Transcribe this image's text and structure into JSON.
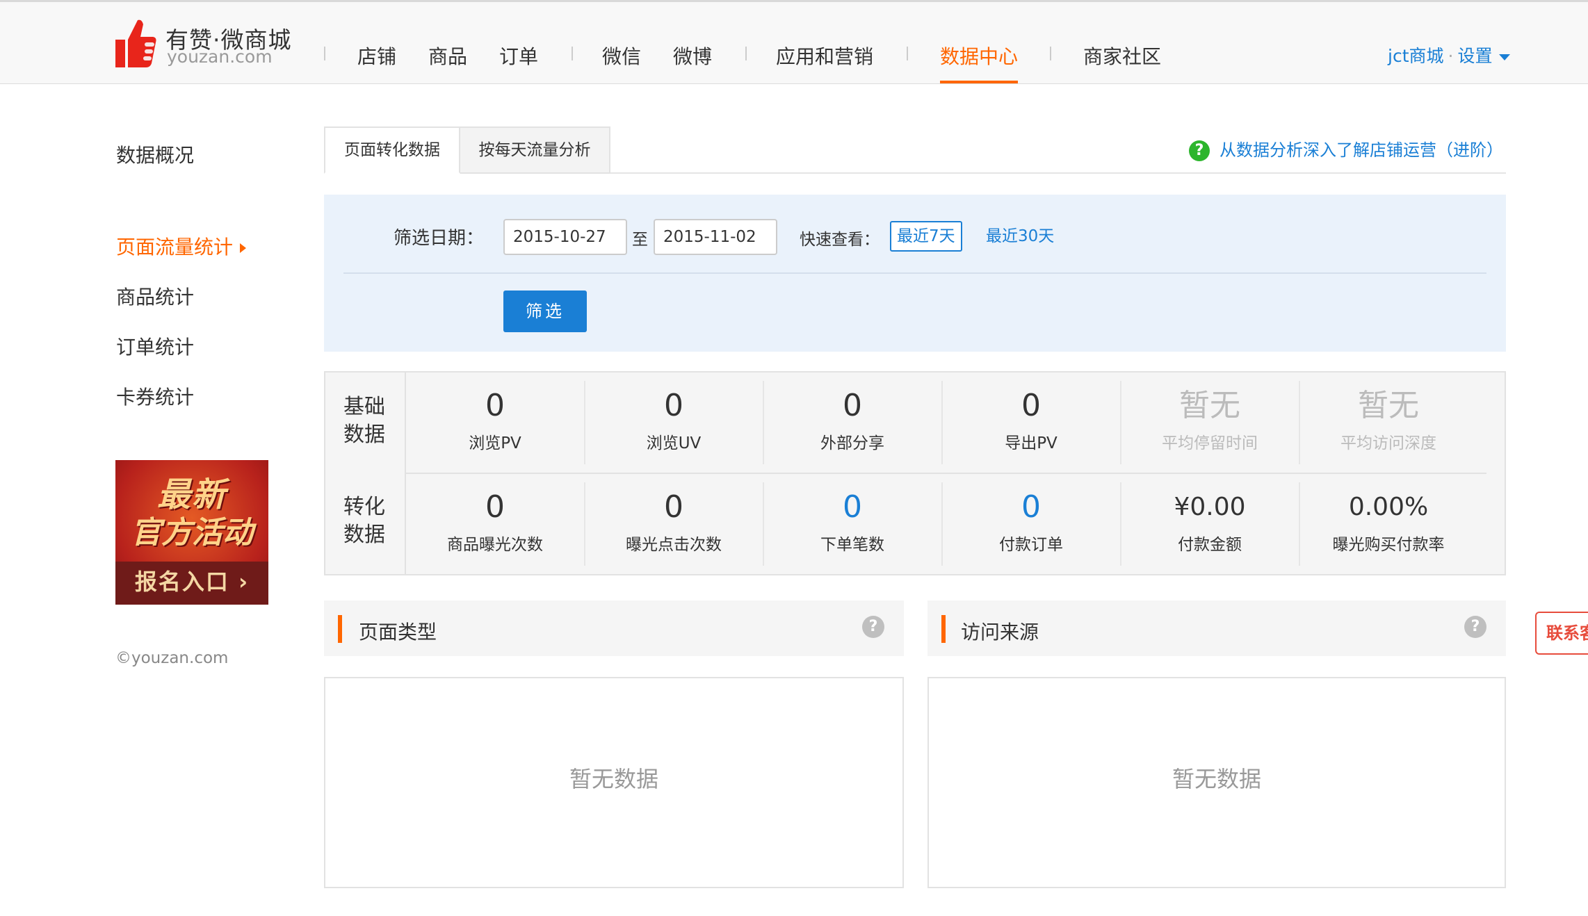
{
  "header": {
    "logo_title": "有赞·微商城",
    "logo_sub": "youzan.com",
    "nav": [
      {
        "label": "店铺"
      },
      {
        "label": "商品"
      },
      {
        "label": "订单"
      },
      {
        "label": "微信"
      },
      {
        "label": "微博"
      },
      {
        "label": "应用和营销"
      },
      {
        "label": "数据中心",
        "active": true
      },
      {
        "label": "商家社区"
      }
    ],
    "user": "jct商城",
    "user_sep": "·",
    "settings": "设置"
  },
  "sidebar": {
    "items": [
      {
        "label": "数据概况"
      },
      {
        "label": "页面流量统计",
        "active": true
      },
      {
        "label": "商品统计"
      },
      {
        "label": "订单统计"
      },
      {
        "label": "卡券统计"
      }
    ],
    "promo": {
      "line1": "最新",
      "line2": "官方活动",
      "cta": "报名入口 ›"
    },
    "copyright": "©youzan.com"
  },
  "tabs": [
    {
      "label": "页面转化数据",
      "active": true
    },
    {
      "label": "按每天流量分析"
    }
  ],
  "help_link": "从数据分析深入了解店铺运营（进阶）",
  "filter": {
    "date_label": "筛选日期：",
    "start_date": "2015-10-27",
    "to": "至",
    "end_date": "2015-11-02",
    "quick_label": "快速查看：",
    "quick": [
      {
        "label": "最近7天",
        "selected": true
      },
      {
        "label": "最近30天"
      }
    ],
    "button": "筛选"
  },
  "stats": {
    "basic": {
      "title": "基础数据",
      "items": [
        {
          "value": "0",
          "label": "浏览PV"
        },
        {
          "value": "0",
          "label": "浏览UV"
        },
        {
          "value": "0",
          "label": "外部分享"
        },
        {
          "value": "0",
          "label": "导出PV"
        },
        {
          "value": "暂无",
          "label": "平均停留时间",
          "muted": true
        },
        {
          "value": "暂无",
          "label": "平均访问深度",
          "muted": true
        }
      ]
    },
    "conversion": {
      "title": "转化数据",
      "items": [
        {
          "value": "0",
          "label": "商品曝光次数"
        },
        {
          "value": "0",
          "label": "曝光点击次数"
        },
        {
          "value": "0",
          "label": "下单笔数",
          "link": true
        },
        {
          "value": "0",
          "label": "付款订单",
          "link": true
        },
        {
          "value": "¥0.00",
          "label": "付款金额"
        },
        {
          "value": "0.00%",
          "label": "曝光购买付款率"
        }
      ]
    }
  },
  "panels": [
    {
      "title": "页面类型",
      "empty": "暂无数据"
    },
    {
      "title": "访问来源",
      "empty": "暂无数据"
    }
  ],
  "contact": "联系客服",
  "colors": {
    "accent": "#ff6600",
    "link": "#1a7fd5",
    "help_green": "#2cb52c"
  }
}
